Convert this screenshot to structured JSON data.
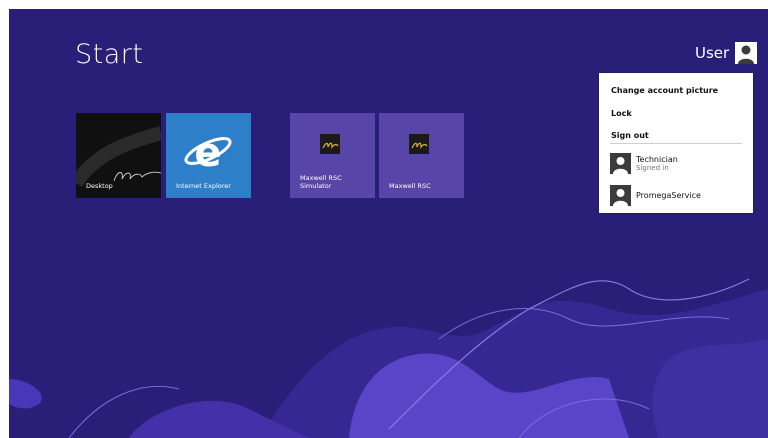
{
  "start": {
    "title": "Start"
  },
  "user": {
    "name": "User"
  },
  "tiles": [
    {
      "label": "Desktop",
      "icon": "desktop-signature-art"
    },
    {
      "label": "Internet Explorer",
      "icon": "internet-explorer-icon"
    },
    {
      "label": "Maxwell RSC\nSimulator",
      "icon": "maxwell-logo-icon"
    },
    {
      "label": "Maxwell RSC",
      "icon": "maxwell-logo-icon"
    }
  ],
  "account_menu": {
    "change_picture": "Change account picture",
    "lock": "Lock",
    "sign_out": "Sign out",
    "accounts": [
      {
        "name": "Technician",
        "status": "Signed in"
      },
      {
        "name": "PromegaService",
        "status": ""
      }
    ]
  },
  "colors": {
    "background": "#2a1f78",
    "ie_tile": "#2e7fc9",
    "app_tile": "#5746a8",
    "desktop_tile": "#101010"
  }
}
